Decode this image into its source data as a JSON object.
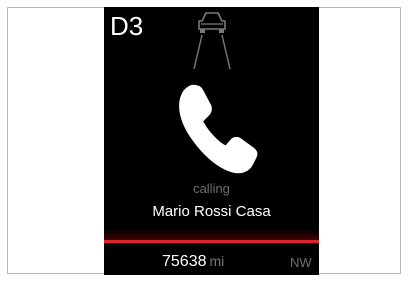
{
  "cluster": {
    "gear": "D3",
    "call": {
      "status": "calling",
      "contact": "Mario Rossi Casa"
    },
    "odometer": {
      "value": "75638",
      "unit": "mi"
    },
    "heading": "NW"
  },
  "icons": {
    "car": "car-front-icon",
    "phone": "phone-handset-icon"
  },
  "colors": {
    "background": "#000000",
    "accent": "#e0242c",
    "text": "#ffffff",
    "muted": "#6f6f6f"
  }
}
